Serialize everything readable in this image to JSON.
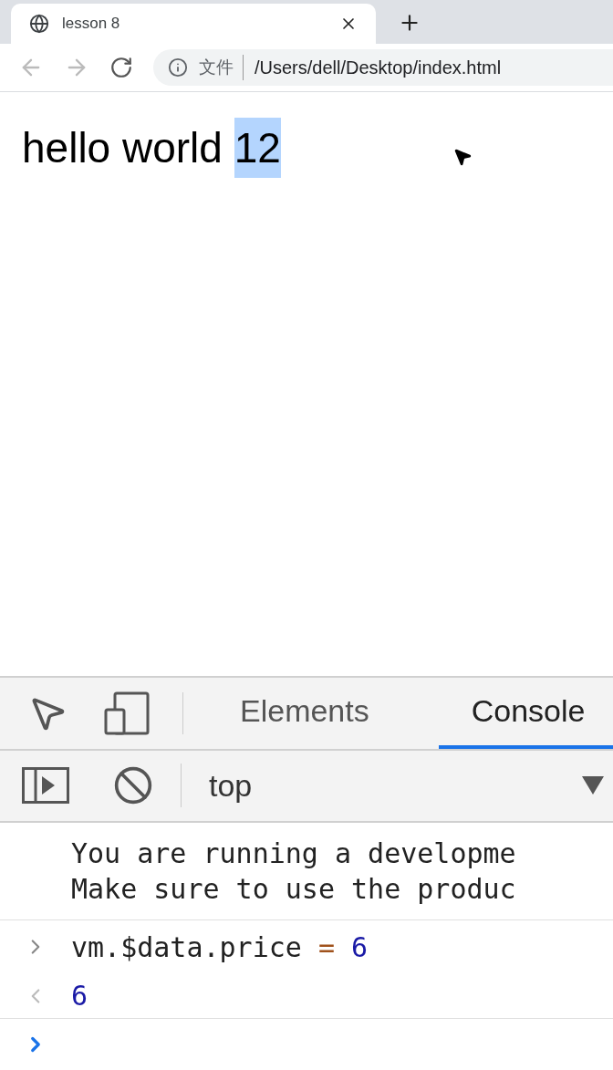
{
  "browser_tab": {
    "title": "lesson 8"
  },
  "address_bar": {
    "label": "文件",
    "url": "/Users/dell/Desktop/index.html"
  },
  "page": {
    "text": "hello world",
    "selected_text": "12"
  },
  "devtools": {
    "tabs": [
      {
        "label": "Elements",
        "selected": false
      },
      {
        "label": "Console",
        "selected": true
      }
    ],
    "context": "top",
    "messages": [
      "You are running a developme",
      "Make sure to use the produc"
    ],
    "input": [
      {
        "kind": "plain",
        "text": "vm.$data.price"
      },
      {
        "kind": "operator",
        "text": "="
      },
      {
        "kind": "number",
        "text": "6"
      }
    ],
    "result": "6"
  }
}
